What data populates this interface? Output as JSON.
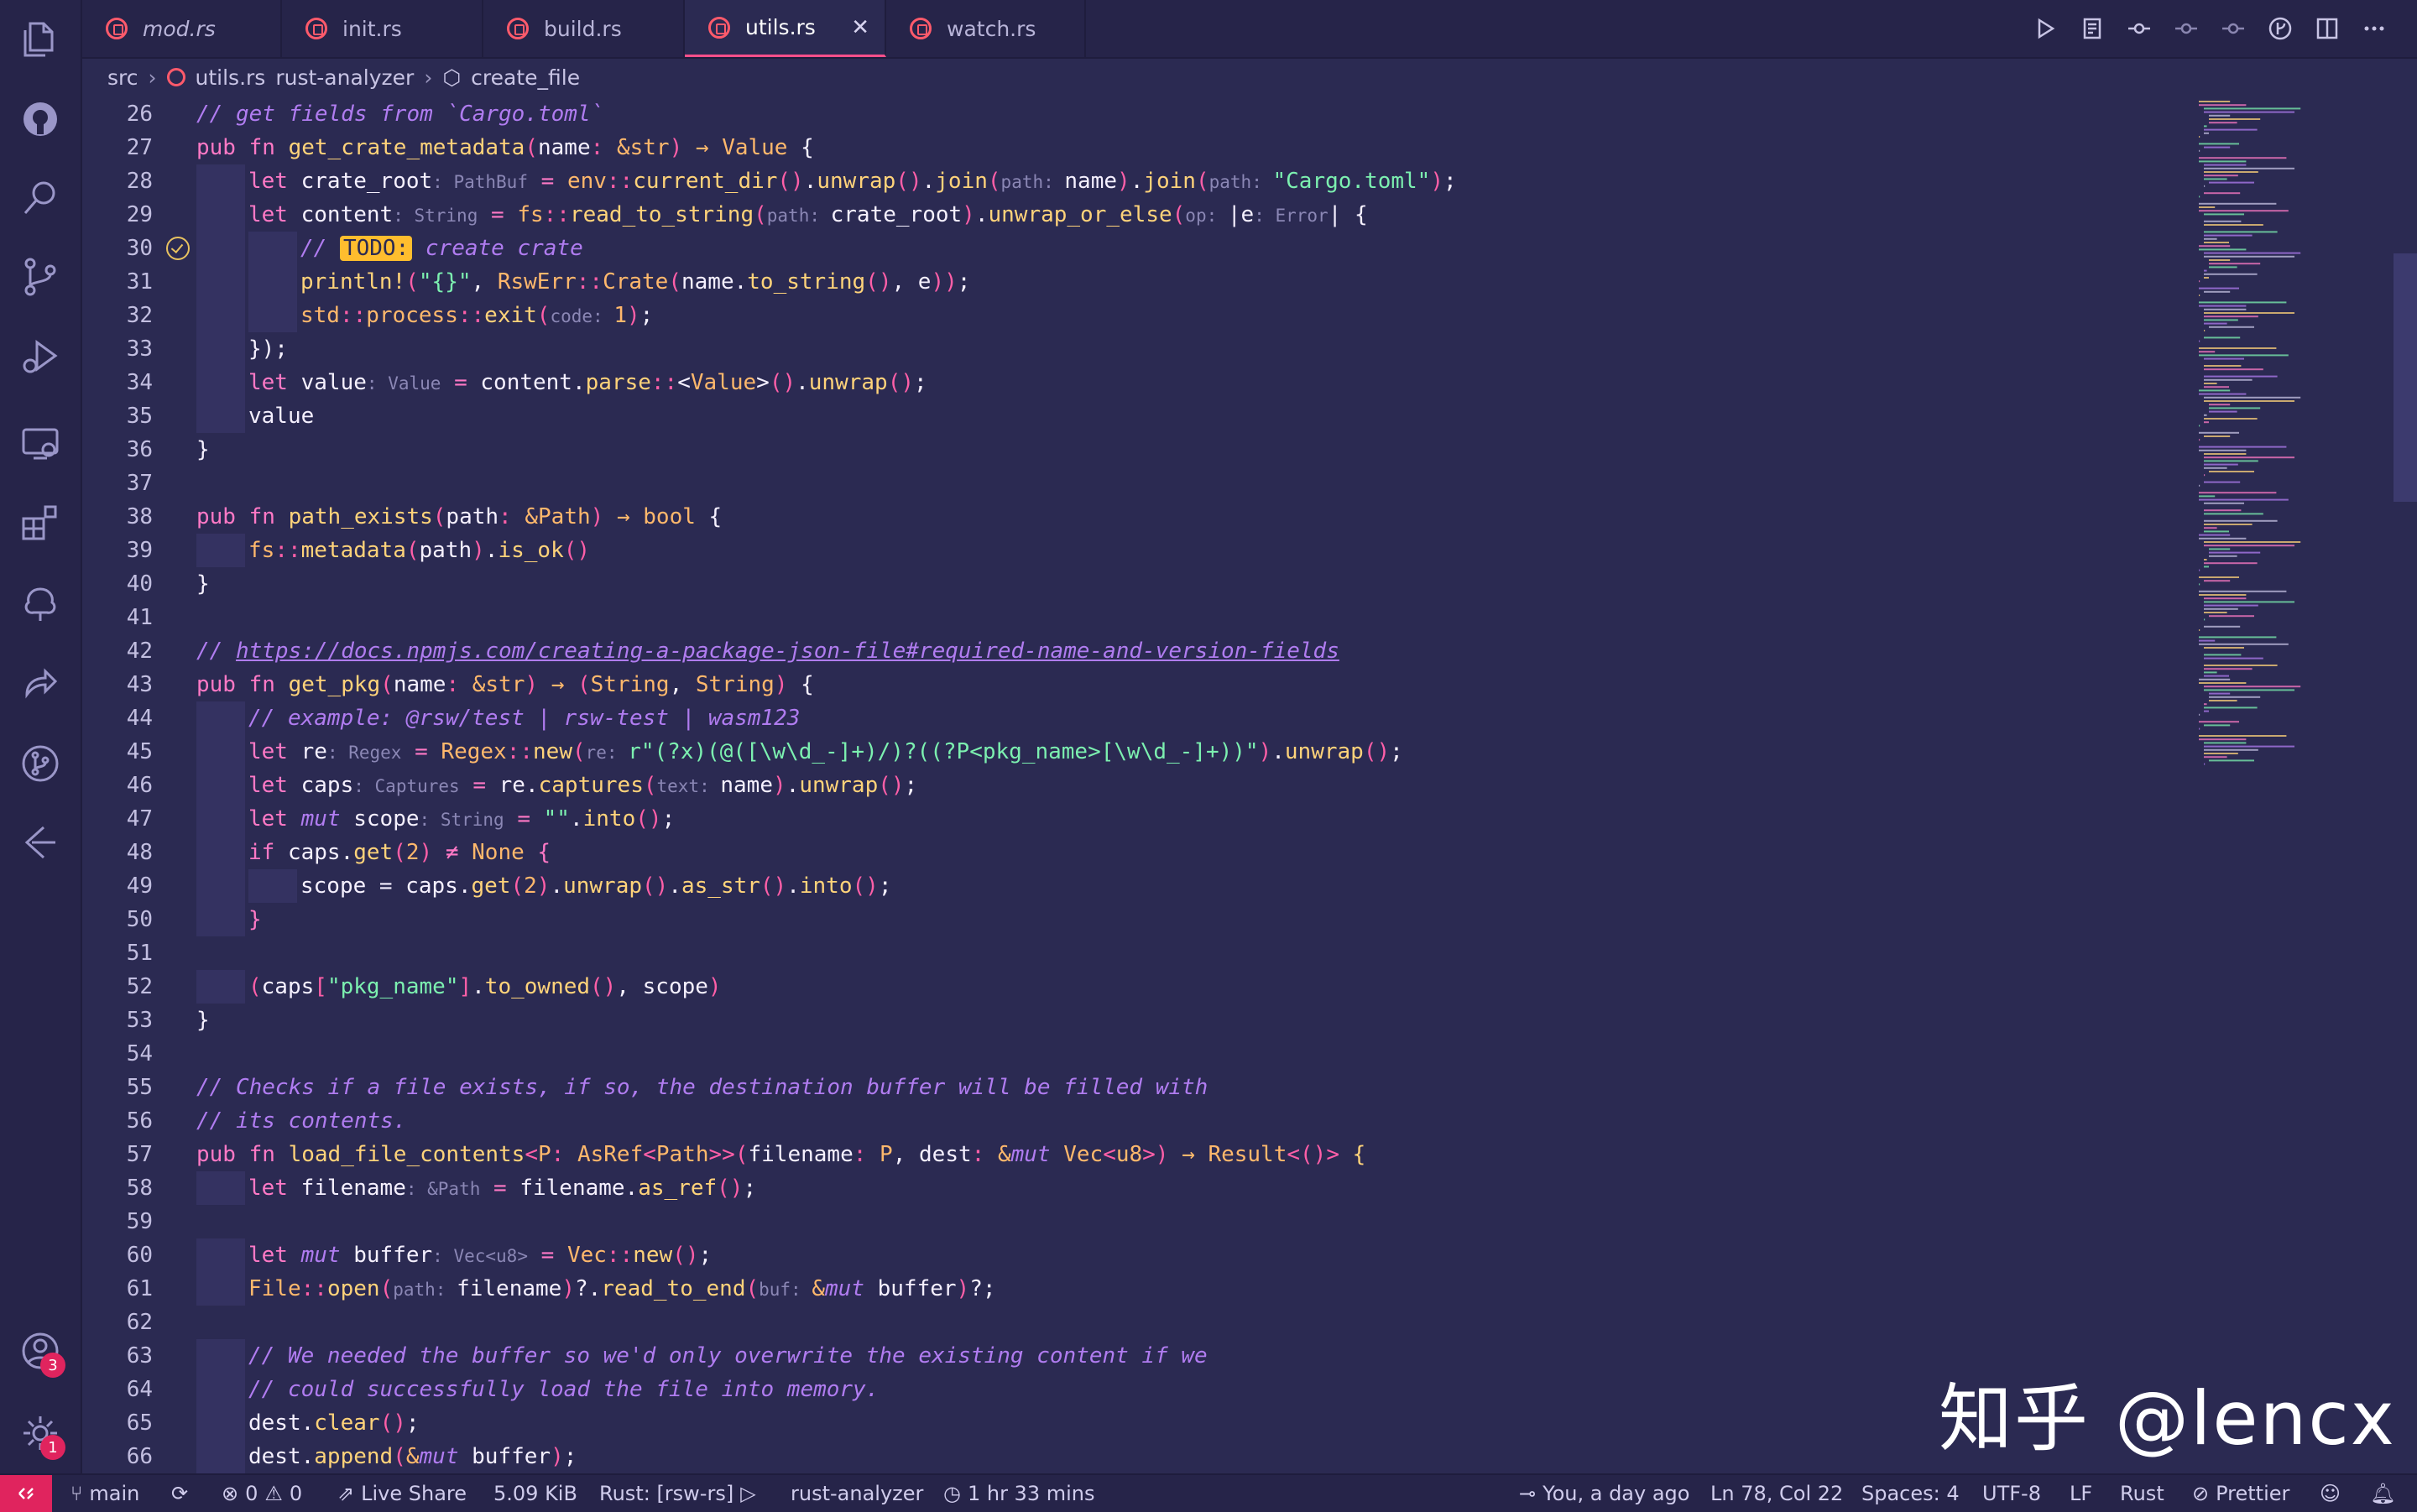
{
  "tabs": [
    {
      "label": "mod.rs",
      "active": false
    },
    {
      "label": "init.rs",
      "active": false
    },
    {
      "label": "build.rs",
      "active": false
    },
    {
      "label": "utils.rs",
      "active": true
    },
    {
      "label": "watch.rs",
      "active": false
    }
  ],
  "tab_close": "✕",
  "breadcrumb": [
    "src",
    "utils.rs",
    "rust-analyzer",
    "create_file"
  ],
  "activity_badges": {
    "accounts": "3",
    "settings": "1"
  },
  "lines": [
    {
      "n": 26,
      "indent": 0,
      "tokens": [
        [
          "c",
          "// get fields from `Cargo.toml`"
        ]
      ]
    },
    {
      "n": 27,
      "indent": 0,
      "tokens": [
        [
          "k",
          "pub fn "
        ],
        [
          "f",
          "get_crate_metadata"
        ],
        [
          "p",
          "("
        ],
        [
          "n",
          "name"
        ],
        [
          "p",
          ": "
        ],
        [
          "t",
          "&str"
        ],
        [
          "p",
          ") "
        ],
        [
          "t",
          "→ "
        ],
        [
          "t",
          "Value"
        ],
        [
          "n",
          " {"
        ]
      ]
    },
    {
      "n": 28,
      "indent": 1,
      "tokens": [
        [
          "k",
          "let "
        ],
        [
          "n",
          "crate_root"
        ],
        [
          "h",
          ": PathBuf"
        ],
        [
          "k",
          " = "
        ],
        [
          "t",
          "env"
        ],
        [
          "p",
          "::"
        ],
        [
          "f",
          "current_dir"
        ],
        [
          "p",
          "()"
        ],
        [
          "n",
          "."
        ],
        [
          "f",
          "unwrap"
        ],
        [
          "p",
          "()"
        ],
        [
          "n",
          "."
        ],
        [
          "f",
          "join"
        ],
        [
          "p",
          "("
        ],
        [
          "h",
          "path: "
        ],
        [
          "n",
          "name"
        ],
        [
          "p",
          ")"
        ],
        [
          "n",
          "."
        ],
        [
          "f",
          "join"
        ],
        [
          "p",
          "("
        ],
        [
          "h",
          "path: "
        ],
        [
          "s",
          "\"Cargo.toml\""
        ],
        [
          "p",
          ")"
        ],
        [
          "n",
          ";"
        ]
      ]
    },
    {
      "n": 29,
      "indent": 1,
      "tokens": [
        [
          "k",
          "let "
        ],
        [
          "n",
          "content"
        ],
        [
          "h",
          ": String"
        ],
        [
          "k",
          " = "
        ],
        [
          "t",
          "fs"
        ],
        [
          "p",
          "::"
        ],
        [
          "f",
          "read_to_string"
        ],
        [
          "p",
          "("
        ],
        [
          "h",
          "path: "
        ],
        [
          "n",
          "crate_root"
        ],
        [
          "p",
          ")"
        ],
        [
          "n",
          "."
        ],
        [
          "f",
          "unwrap_or_else"
        ],
        [
          "p",
          "("
        ],
        [
          "h",
          "op: "
        ],
        [
          "n",
          "|e"
        ],
        [
          "h",
          ": Error"
        ],
        [
          "n",
          "| {"
        ]
      ]
    },
    {
      "n": 30,
      "indent": 2,
      "check": true,
      "tokens": [
        [
          "c",
          "// "
        ],
        [
          "todo",
          "TODO:"
        ],
        [
          "c",
          " create crate"
        ]
      ]
    },
    {
      "n": 31,
      "indent": 2,
      "tokens": [
        [
          "f",
          "println!"
        ],
        [
          "p",
          "("
        ],
        [
          "s",
          "\"{}\""
        ],
        [
          "n",
          ", "
        ],
        [
          "t",
          "RswErr"
        ],
        [
          "p",
          "::"
        ],
        [
          "t",
          "Crate"
        ],
        [
          "p",
          "("
        ],
        [
          "n",
          "name."
        ],
        [
          "f",
          "to_string"
        ],
        [
          "p",
          "()"
        ],
        [
          "n",
          ", e"
        ],
        [
          "p",
          "))"
        ],
        [
          "n",
          ";"
        ]
      ]
    },
    {
      "n": 32,
      "indent": 2,
      "tokens": [
        [
          "t",
          "std"
        ],
        [
          "p",
          "::"
        ],
        [
          "t",
          "process"
        ],
        [
          "p",
          "::"
        ],
        [
          "f",
          "exit"
        ],
        [
          "p",
          "("
        ],
        [
          "h",
          "code: "
        ],
        [
          "t",
          "1"
        ],
        [
          "p",
          ")"
        ],
        [
          "n",
          ";"
        ]
      ]
    },
    {
      "n": 33,
      "indent": 1,
      "tokens": [
        [
          "n",
          "});"
        ]
      ]
    },
    {
      "n": 34,
      "indent": 1,
      "tokens": [
        [
          "k",
          "let "
        ],
        [
          "n",
          "value"
        ],
        [
          "h",
          ": Value"
        ],
        [
          "k",
          " = "
        ],
        [
          "n",
          "content."
        ],
        [
          "f",
          "parse"
        ],
        [
          "p",
          "::"
        ],
        [
          "n",
          "<"
        ],
        [
          "t",
          "Value"
        ],
        [
          "n",
          ">"
        ],
        [
          "p",
          "()"
        ],
        [
          "n",
          "."
        ],
        [
          "f",
          "unwrap"
        ],
        [
          "p",
          "()"
        ],
        [
          "n",
          ";"
        ]
      ]
    },
    {
      "n": 35,
      "indent": 1,
      "tokens": [
        [
          "n",
          "value"
        ]
      ]
    },
    {
      "n": 36,
      "indent": 0,
      "tokens": [
        [
          "n",
          "}"
        ]
      ]
    },
    {
      "n": 37,
      "indent": 0,
      "tokens": []
    },
    {
      "n": 38,
      "indent": 0,
      "tokens": [
        [
          "k",
          "pub fn "
        ],
        [
          "f",
          "path_exists"
        ],
        [
          "p",
          "("
        ],
        [
          "n",
          "path"
        ],
        [
          "p",
          ": "
        ],
        [
          "t",
          "&Path"
        ],
        [
          "p",
          ") "
        ],
        [
          "t",
          "→ "
        ],
        [
          "t",
          "bool"
        ],
        [
          "n",
          " {"
        ]
      ]
    },
    {
      "n": 39,
      "indent": 1,
      "tokens": [
        [
          "t",
          "fs"
        ],
        [
          "p",
          "::"
        ],
        [
          "f",
          "metadata"
        ],
        [
          "p",
          "("
        ],
        [
          "n",
          "path"
        ],
        [
          "p",
          ")"
        ],
        [
          "n",
          "."
        ],
        [
          "f",
          "is_ok"
        ],
        [
          "p",
          "()"
        ]
      ]
    },
    {
      "n": 40,
      "indent": 0,
      "tokens": [
        [
          "n",
          "}"
        ]
      ]
    },
    {
      "n": 41,
      "indent": 0,
      "tokens": []
    },
    {
      "n": 42,
      "indent": 0,
      "tokens": [
        [
          "c",
          "// "
        ],
        [
          "u",
          "https://docs.npmjs.com/creating-a-package-json-file#required-name-and-version-fields"
        ]
      ]
    },
    {
      "n": 43,
      "indent": 0,
      "tokens": [
        [
          "k",
          "pub fn "
        ],
        [
          "f",
          "get_pkg"
        ],
        [
          "p",
          "("
        ],
        [
          "n",
          "name"
        ],
        [
          "p",
          ": "
        ],
        [
          "t",
          "&str"
        ],
        [
          "p",
          ") "
        ],
        [
          "t",
          "→ "
        ],
        [
          "p",
          "("
        ],
        [
          "t",
          "String"
        ],
        [
          "n",
          ", "
        ],
        [
          "t",
          "String"
        ],
        [
          "p",
          ")"
        ],
        [
          "n",
          " {"
        ]
      ]
    },
    {
      "n": 44,
      "indent": 1,
      "tokens": [
        [
          "c",
          "// example: @rsw/test | rsw-test | wasm123"
        ]
      ]
    },
    {
      "n": 45,
      "indent": 1,
      "tokens": [
        [
          "k",
          "let "
        ],
        [
          "n",
          "re"
        ],
        [
          "h",
          ": Regex"
        ],
        [
          "k",
          " = "
        ],
        [
          "t",
          "Regex"
        ],
        [
          "p",
          "::"
        ],
        [
          "f",
          "new"
        ],
        [
          "p",
          "("
        ],
        [
          "h",
          "re: "
        ],
        [
          "s",
          "r\"(?x)(@([\\w\\d_-]+)/)?((?P<pkg_name>[\\w\\d_-]+))\""
        ],
        [
          "p",
          ")"
        ],
        [
          "n",
          "."
        ],
        [
          "f",
          "unwrap"
        ],
        [
          "p",
          "()"
        ],
        [
          "n",
          ";"
        ]
      ]
    },
    {
      "n": 46,
      "indent": 1,
      "tokens": [
        [
          "k",
          "let "
        ],
        [
          "n",
          "caps"
        ],
        [
          "h",
          ": Captures"
        ],
        [
          "k",
          " = "
        ],
        [
          "n",
          "re."
        ],
        [
          "f",
          "captures"
        ],
        [
          "p",
          "("
        ],
        [
          "h",
          "text: "
        ],
        [
          "n",
          "name"
        ],
        [
          "p",
          ")"
        ],
        [
          "n",
          "."
        ],
        [
          "f",
          "unwrap"
        ],
        [
          "p",
          "()"
        ],
        [
          "n",
          ";"
        ]
      ]
    },
    {
      "n": 47,
      "indent": 1,
      "tokens": [
        [
          "k",
          "let "
        ],
        [
          "c",
          "mut "
        ],
        [
          "n",
          "scope"
        ],
        [
          "h",
          ": String"
        ],
        [
          "k",
          " = "
        ],
        [
          "s",
          "\"\""
        ],
        [
          "n",
          "."
        ],
        [
          "f",
          "into"
        ],
        [
          "p",
          "()"
        ],
        [
          "n",
          ";"
        ]
      ]
    },
    {
      "n": 48,
      "indent": 1,
      "tokens": [
        [
          "k",
          "if "
        ],
        [
          "n",
          "caps."
        ],
        [
          "f",
          "get"
        ],
        [
          "p",
          "("
        ],
        [
          "t",
          "2"
        ],
        [
          "p",
          ")"
        ],
        [
          "k",
          " ≠ "
        ],
        [
          "t",
          "None"
        ],
        [
          "k",
          " {"
        ]
      ]
    },
    {
      "n": 49,
      "indent": 2,
      "tokens": [
        [
          "n",
          "scope = caps."
        ],
        [
          "f",
          "get"
        ],
        [
          "p",
          "("
        ],
        [
          "t",
          "2"
        ],
        [
          "p",
          ")"
        ],
        [
          "n",
          "."
        ],
        [
          "f",
          "unwrap"
        ],
        [
          "p",
          "()"
        ],
        [
          "n",
          "."
        ],
        [
          "f",
          "as_str"
        ],
        [
          "p",
          "()"
        ],
        [
          "n",
          "."
        ],
        [
          "f",
          "into"
        ],
        [
          "p",
          "()"
        ],
        [
          "n",
          ";"
        ]
      ]
    },
    {
      "n": 50,
      "indent": 1,
      "tokens": [
        [
          "k",
          "}"
        ]
      ]
    },
    {
      "n": 51,
      "indent": 0,
      "tokens": []
    },
    {
      "n": 52,
      "indent": 1,
      "tokens": [
        [
          "p",
          "("
        ],
        [
          "n",
          "caps"
        ],
        [
          "p",
          "["
        ],
        [
          "s",
          "\"pkg_name\""
        ],
        [
          "p",
          "]"
        ],
        [
          "n",
          "."
        ],
        [
          "f",
          "to_owned"
        ],
        [
          "p",
          "()"
        ],
        [
          "n",
          ", scope"
        ],
        [
          "p",
          ")"
        ]
      ]
    },
    {
      "n": 53,
      "indent": 0,
      "tokens": [
        [
          "n",
          "}"
        ]
      ]
    },
    {
      "n": 54,
      "indent": 0,
      "tokens": []
    },
    {
      "n": 55,
      "indent": 0,
      "tokens": [
        [
          "c",
          "// Checks if a file exists, if so, the destination buffer will be filled with"
        ]
      ]
    },
    {
      "n": 56,
      "indent": 0,
      "tokens": [
        [
          "c",
          "// its contents."
        ]
      ]
    },
    {
      "n": 57,
      "indent": 0,
      "tokens": [
        [
          "k",
          "pub fn "
        ],
        [
          "f",
          "load_file_contents"
        ],
        [
          "p",
          "<"
        ],
        [
          "t",
          "P"
        ],
        [
          "p",
          ": "
        ],
        [
          "t",
          "AsRef"
        ],
        [
          "p",
          "<"
        ],
        [
          "t",
          "Path"
        ],
        [
          "p",
          ">>"
        ],
        [
          "p",
          "("
        ],
        [
          "n",
          "filename"
        ],
        [
          "p",
          ": "
        ],
        [
          "t",
          "P"
        ],
        [
          "n",
          ", dest"
        ],
        [
          "p",
          ": "
        ],
        [
          "t",
          "&"
        ],
        [
          "c",
          "mut "
        ],
        [
          "t",
          "Vec"
        ],
        [
          "p",
          "<"
        ],
        [
          "t",
          "u8"
        ],
        [
          "p",
          ">) "
        ],
        [
          "t",
          "→ "
        ],
        [
          "t",
          "Result"
        ],
        [
          "p",
          "<()>"
        ],
        [
          "f",
          " {"
        ]
      ]
    },
    {
      "n": 58,
      "indent": 1,
      "tokens": [
        [
          "k",
          "let "
        ],
        [
          "n",
          "filename"
        ],
        [
          "h",
          ": &Path"
        ],
        [
          "k",
          " = "
        ],
        [
          "n",
          "filename."
        ],
        [
          "f",
          "as_ref"
        ],
        [
          "p",
          "()"
        ],
        [
          "n",
          ";"
        ]
      ]
    },
    {
      "n": 59,
      "indent": 0,
      "tokens": []
    },
    {
      "n": 60,
      "indent": 1,
      "tokens": [
        [
          "k",
          "let "
        ],
        [
          "c",
          "mut "
        ],
        [
          "n",
          "buffer"
        ],
        [
          "h",
          ": Vec<u8>"
        ],
        [
          "k",
          " = "
        ],
        [
          "t",
          "Vec"
        ],
        [
          "p",
          "::"
        ],
        [
          "f",
          "new"
        ],
        [
          "p",
          "()"
        ],
        [
          "n",
          ";"
        ]
      ]
    },
    {
      "n": 61,
      "indent": 1,
      "tokens": [
        [
          "t",
          "File"
        ],
        [
          "p",
          "::"
        ],
        [
          "f",
          "open"
        ],
        [
          "p",
          "("
        ],
        [
          "h",
          "path: "
        ],
        [
          "n",
          "filename"
        ],
        [
          "p",
          ")"
        ],
        [
          "n",
          "?."
        ],
        [
          "f",
          "read_to_end"
        ],
        [
          "p",
          "("
        ],
        [
          "h",
          "buf: "
        ],
        [
          "t",
          "&"
        ],
        [
          "c",
          "mut "
        ],
        [
          "n",
          "buffer"
        ],
        [
          "p",
          ")"
        ],
        [
          "n",
          "?;"
        ]
      ]
    },
    {
      "n": 62,
      "indent": 0,
      "tokens": []
    },
    {
      "n": 63,
      "indent": 1,
      "tokens": [
        [
          "c",
          "// We needed the buffer so we'd only overwrite the existing content if we"
        ]
      ]
    },
    {
      "n": 64,
      "indent": 1,
      "tokens": [
        [
          "c",
          "// could successfully load the file into memory."
        ]
      ]
    },
    {
      "n": 65,
      "indent": 1,
      "tokens": [
        [
          "n",
          "dest."
        ],
        [
          "f",
          "clear"
        ],
        [
          "p",
          "()"
        ],
        [
          "n",
          ";"
        ]
      ]
    },
    {
      "n": 66,
      "indent": 1,
      "tokens": [
        [
          "n",
          "dest."
        ],
        [
          "f",
          "append"
        ],
        [
          "p",
          "("
        ],
        [
          "t",
          "&"
        ],
        [
          "c",
          "mut "
        ],
        [
          "n",
          "buffer"
        ],
        [
          "p",
          ")"
        ],
        [
          "n",
          ";"
        ]
      ]
    }
  ],
  "watermark": "知乎 @lencx",
  "status": {
    "branch": "main",
    "errors": "0",
    "warnings": "0",
    "live_share": "Live Share",
    "size": "5.09 KiB",
    "rust_target": "Rust: [rsw-rs]",
    "analyzer": "rust-analyzer",
    "time": "1 hr 33 mins",
    "blame": "You, a day ago",
    "position": "Ln 78, Col 22",
    "spaces": "Spaces: 4",
    "encoding": "UTF-8",
    "eol": "LF",
    "language": "Rust",
    "formatter": "Prettier"
  },
  "colors": {
    "accent": "#ff4f8b",
    "background": "#2b2a52",
    "badge": "#e0245e"
  }
}
